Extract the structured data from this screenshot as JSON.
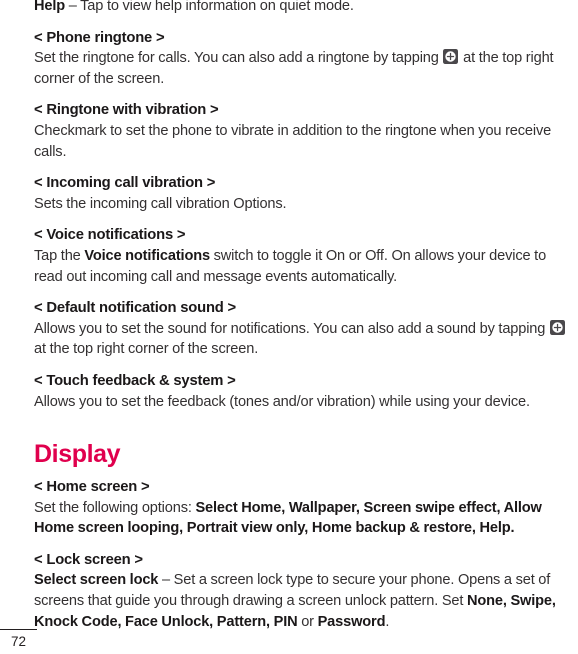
{
  "document": {
    "page_number": "72",
    "accent_color": "#E0004D",
    "text_color": "#333031"
  },
  "icons": {
    "add_icon_name": "plus-circle-icon"
  },
  "content": {
    "help_entry": {
      "term": "Help",
      "dash": " – ",
      "description": "Tap to view help information on quiet mode."
    },
    "phone_ringtone": {
      "heading": "< Phone ringtone >",
      "body_before_icon": "Set the ringtone for calls. You can also add a ringtone by tapping ",
      "body_after_icon": " at the top right corner of the screen."
    },
    "ringtone_with_vibration": {
      "heading": "< Ringtone with vibration >",
      "body": "Checkmark to set the phone to vibrate in addition to the ringtone when you receive calls."
    },
    "incoming_call_vibration": {
      "heading": "< Incoming call vibration >",
      "body": "Sets the incoming call vibration Options."
    },
    "voice_notifications": {
      "heading": "< Voice notifications >",
      "body_part1": "Tap the ",
      "body_bold": "Voice notifications",
      "body_part2": " switch to toggle it On or Off. On allows your device to read out incoming call and message events automatically."
    },
    "default_notification_sound": {
      "heading": "< Default notification sound >",
      "body_before_icon": "Allows you to set the sound for notifications. You can also add a sound by tapping ",
      "body_after_icon": " at the top right corner of the screen."
    },
    "touch_feedback_system": {
      "heading": "< Touch feedback & system >",
      "body": "Allows you to set the feedback (tones and/or vibration) while using your device."
    },
    "display_chapter": {
      "title": "Display"
    },
    "home_screen": {
      "heading": "< Home screen >",
      "body_intro": "Set the following options: ",
      "body_options": "Select Home, Wallpaper, Screen swipe effect, Allow Home screen looping, Portrait view only, Home backup & restore, Help.",
      "body_tail": ""
    },
    "lock_screen": {
      "heading": "< Lock screen >",
      "body_bold_term": "Select screen lock",
      "body_part1": " – Set a screen lock type to secure your phone. Opens a set of screens that guide you through drawing a screen unlock pattern. Set ",
      "body_bold_options": "None, Swipe, Knock Code, Face Unlock, Pattern, PIN",
      "body_part2": " or ",
      "body_bold_password": "Password",
      "body_part3": "."
    }
  }
}
